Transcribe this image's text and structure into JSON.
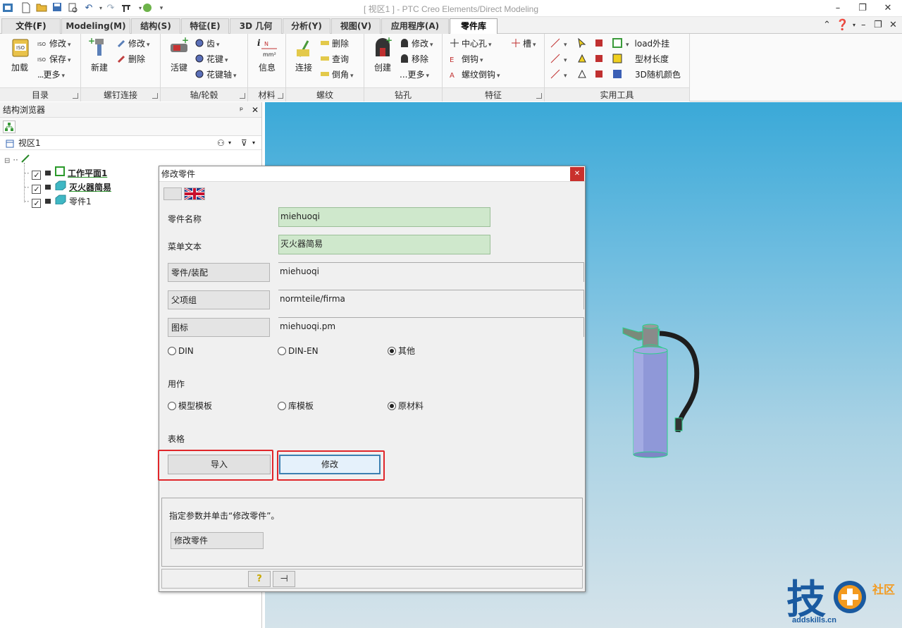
{
  "window": {
    "title": "[ 视区1 ] - PTC Creo Elements/Direct Modeling"
  },
  "quick_access": [
    "app-icon",
    "new-icon",
    "open-icon",
    "save-icon",
    "print-icon",
    "undo-icon",
    "redo-icon",
    "tools-icon",
    "globe-icon"
  ],
  "tabs": [
    {
      "label": "文件(F)"
    },
    {
      "label": "Modeling(M)"
    },
    {
      "label": "结构(S)"
    },
    {
      "label": "特征(E)"
    },
    {
      "label": "3D 几何"
    },
    {
      "label": "分析(Y)"
    },
    {
      "label": "视图(V)"
    },
    {
      "label": "应用程序(A)"
    },
    {
      "label": "零件库"
    }
  ],
  "active_tab": "零件库",
  "ribbon": {
    "groups": [
      {
        "label": "目录",
        "big": "加载",
        "small": [
          "修改",
          "保存",
          "更多"
        ]
      },
      {
        "label": "螺钉连接",
        "big": "新建",
        "small": [
          "修改",
          "删除"
        ]
      },
      {
        "label": "轴/轮毂",
        "big": "活键",
        "small": [
          "齿",
          "花键",
          "花键轴"
        ]
      },
      {
        "label": "材料",
        "big": "信息",
        "unit": "N/mm²"
      },
      {
        "label": "螺纹",
        "big": "连接",
        "small": [
          "删除",
          "查询",
          "倒角"
        ]
      },
      {
        "label": "钻孔",
        "big": "创建",
        "small": [
          "修改",
          "移除",
          "更多"
        ]
      },
      {
        "label": "特征",
        "small": [
          "中心孔",
          "倒钩",
          "螺纹倒钩",
          "槽"
        ]
      },
      {
        "label": "实用工具",
        "small": [
          "load外挂",
          "型材长度",
          "3D随机颜色"
        ]
      }
    ]
  },
  "browser": {
    "title": "结构浏览器",
    "view_label": "视区1",
    "items": [
      {
        "label": "工作平面1",
        "checked": true,
        "bold": true
      },
      {
        "label": "灭火器简易",
        "checked": true,
        "bold": true
      },
      {
        "label": "零件1",
        "checked": true,
        "bold": false
      }
    ]
  },
  "dialog": {
    "title": "修改零件",
    "part_name_label": "零件名称",
    "part_name_value": "miehuoqi",
    "menu_text_label": "菜单文本",
    "menu_text_value": "灭火器简易",
    "part_assembly_label": "零件/装配",
    "part_assembly_value": "miehuoqi",
    "parent_group_label": "父项组",
    "parent_group_value": "normteile/firma",
    "icon_label": "图标",
    "icon_value": "miehuoqi.pm",
    "standard_options": [
      "DIN",
      "DIN-EN",
      "其他"
    ],
    "standard_selected": "其他",
    "usage_label": "用作",
    "usage_options": [
      "模型模板",
      "库模板",
      "原材料"
    ],
    "usage_selected": "原材料",
    "table_label": "表格",
    "import_button": "导入",
    "modify_button": "修改",
    "hint": "指定参数并单击“修改零件”。",
    "modify_part_button": "修改零件"
  },
  "watermark": {
    "text": "addskills.cn",
    "chars": "技",
    "badge": "社区"
  },
  "colors": {
    "accent_red": "#e0262a",
    "field_green": "#cfe8cc",
    "viewport_top": "#3aa9d8",
    "extinguisher_body": "#8f98d8",
    "watermark_blue": "#1a5aa0",
    "watermark_orange": "#f39a1f"
  }
}
